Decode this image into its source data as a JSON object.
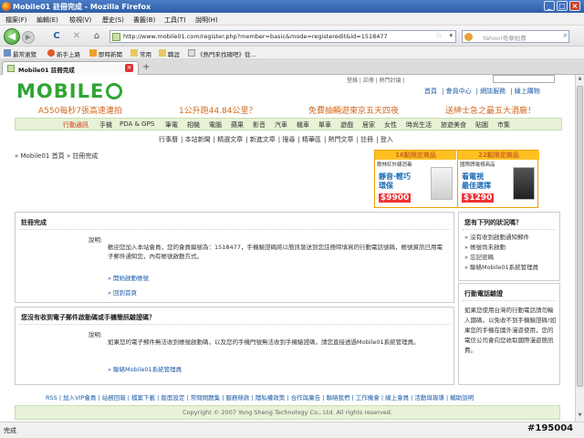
{
  "window": {
    "title": "Mobile01 註冊完成 - Mozilla Firefox",
    "controls": [
      "_",
      "□",
      "×"
    ]
  },
  "menu": [
    "檔案(F)",
    "編輯(E)",
    "檢視(V)",
    "歷史(S)",
    "書籤(B)",
    "工具(T)",
    "說明(H)"
  ],
  "nav": {
    "back": "◀",
    "forward": "▶",
    "reload": "C",
    "stop": "✕",
    "home": "⌂",
    "url": "http://www.mobile01.com/register.php?member=basic&mode=registeredit&id=1518477",
    "search_placeholder": "Yahoo!奇摩拍賣"
  },
  "bookmarks": [
    "最常瀏覽",
    "新手上路",
    "即時新聞",
    "常用",
    "職涯",
    "《熱門來找碴吧》從..."
  ],
  "tab": {
    "label": "Mobile01 註冊完成",
    "new": "+"
  },
  "site": {
    "logo": "MOBILE",
    "toplinks": "登錄  |  註冊  |  熱門討論  |",
    "mainlinks": [
      "首頁",
      "會員中心",
      "網誌服務",
      "線上購物"
    ],
    "promo": [
      "A550每秒7張高速連拍",
      "1公升跑44.84公里？",
      "免費抽輛遊東京五天四夜",
      "送紳士急之最五大酒廠！"
    ],
    "categories": [
      "行動通訊",
      "手機",
      "PDA & GPS",
      "筆電",
      "相機",
      "電腦",
      "蘋果",
      "影音",
      "汽車",
      "機車",
      "單車",
      "遊戲",
      "居家",
      "女性",
      "時尚生活",
      "旅遊美食",
      "貼圖",
      "市集"
    ],
    "subnav": [
      "行事曆",
      "本站新聞",
      "精選文章",
      "新進文章",
      "搜尋",
      "精華區",
      "熱門文章",
      "註冊",
      "登入"
    ],
    "breadcrumb": "» Mobile01 首頁 » 註冊完成",
    "ad": {
      "left": {
        "header": "16點限定商品",
        "sub": "歌林紅外線消毒",
        "tag1": "靜音·輕巧",
        "tag2": "環保",
        "price": "$9900"
      },
      "right": {
        "header": "22點限定商品",
        "sub": "國際牌電視商品",
        "tag1": "看電視",
        "tag2": "最佳選擇",
        "price": "$1290"
      }
    },
    "done_box": {
      "title": "註冊完成",
      "label": "說明:",
      "message": "歡迎您加入本站會員，您的會員編號為：1518477，手機驗證碼將以簡訊發送到您註冊時填寫的行動電話號碼，帳號資訊已用電子郵件通知您，內有帳號啟動方式。",
      "link1": "» 開始啟動帳號",
      "link2": "» 回到首頁"
    },
    "noemail_box": {
      "title": "您沒有收到電子郵件啟動碼或手機簡訊驗證碼？",
      "label": "說明:",
      "message": "如果您的電子郵件無法收到帳號啟動碼，以及您的手機門號無法收到手機驗證碼，請您直接透過Mobile01系統管理員。",
      "link": "» 聯絡Mobile01系統管理員"
    },
    "know_box": {
      "title": "您有下列的狀況嗎？",
      "items": [
        "» 沒有收到啟動通知郵件",
        "» 帳號尚未啟動",
        "» 忘記密碼",
        "» 聯絡Mobile01系統管理員"
      ]
    },
    "phone_box": {
      "title": "行動電話驗證",
      "message": "如果您使用台灣的行動電話請勿輸入國碼，以免收不到手機驗證碼!如果您的手機在國外漫遊使用，您的電信公司會向您收取國際漫遊簡訊費。"
    },
    "footerlinks": "RSS  |  加入VIP會員  |  站務回報  |  檔案下載  |  版面設定  |  常問問題集  |  服務條款  |  隱私權政策  |  合作與廣告  |  聯絡我們  |  工作機會  |  線上會員  |  活動與報導  |  輔助說明",
    "copyright": "Copyright © 2007 Yong Sheng Technology Co., Ltd. All rights reserved."
  },
  "status": "完成",
  "watermark": "#195004"
}
